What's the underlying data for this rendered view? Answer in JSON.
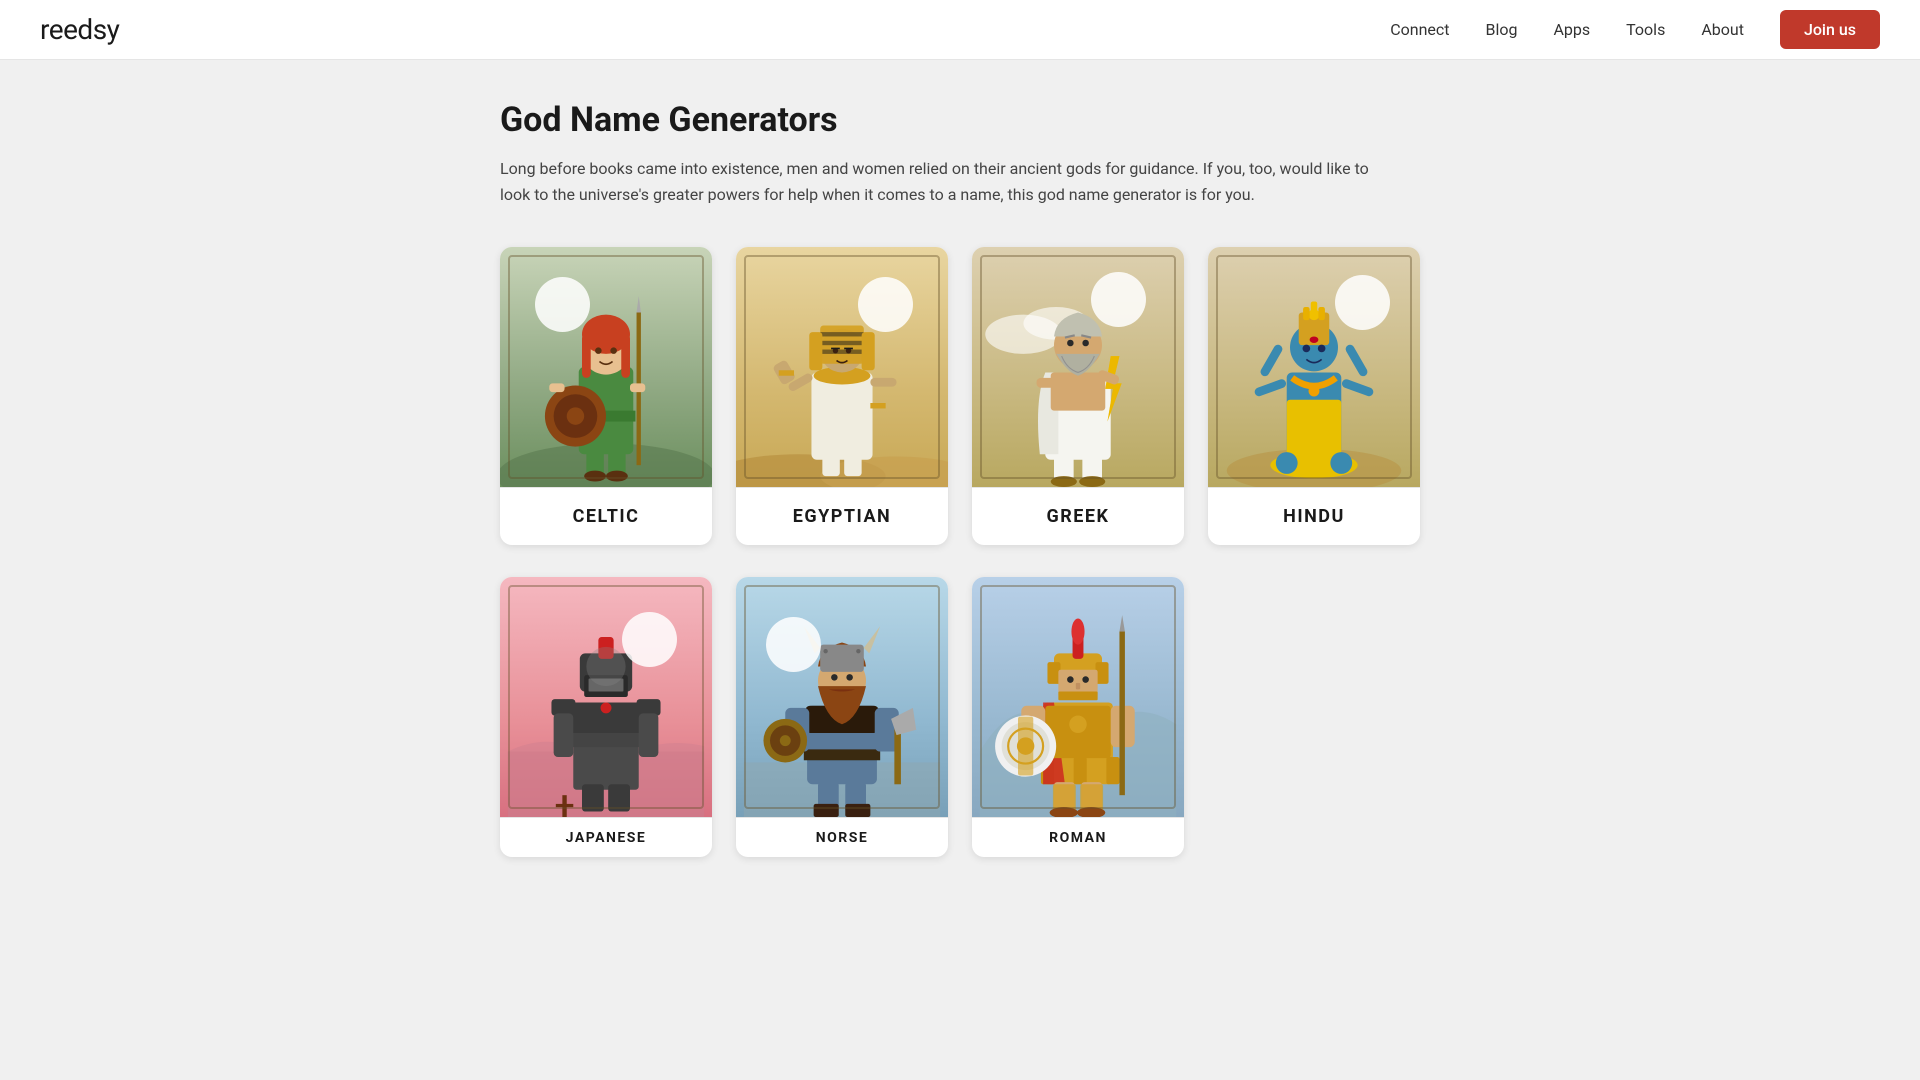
{
  "nav": {
    "logo": "reedsy",
    "links": [
      {
        "label": "Connect",
        "id": "connect"
      },
      {
        "label": "Blog",
        "id": "blog"
      },
      {
        "label": "Apps",
        "id": "apps"
      },
      {
        "label": "Tools",
        "id": "tools"
      },
      {
        "label": "About",
        "id": "about"
      }
    ],
    "join_label": "Join us"
  },
  "page": {
    "title": "God Name Generators",
    "description": "Long before books came into existence, men and women relied on their ancient gods for guidance. If you, too, would like to look to the universe's greater powers for help when it comes to a name, this god name generator is for you."
  },
  "cards_row1": [
    {
      "id": "celtic",
      "label": "CELTIC",
      "bg": "celtic"
    },
    {
      "id": "egyptian",
      "label": "EGYPTIAN",
      "bg": "egyptian"
    },
    {
      "id": "greek",
      "label": "GREEK",
      "bg": "greek"
    },
    {
      "id": "hindu",
      "label": "HINDU",
      "bg": "hindu"
    }
  ],
  "cards_row2": [
    {
      "id": "japanese",
      "label": "JAPANESE",
      "bg": "japanese"
    },
    {
      "id": "norse",
      "label": "NORSE",
      "bg": "norse"
    },
    {
      "id": "roman",
      "label": "ROMAN",
      "bg": "roman"
    }
  ]
}
